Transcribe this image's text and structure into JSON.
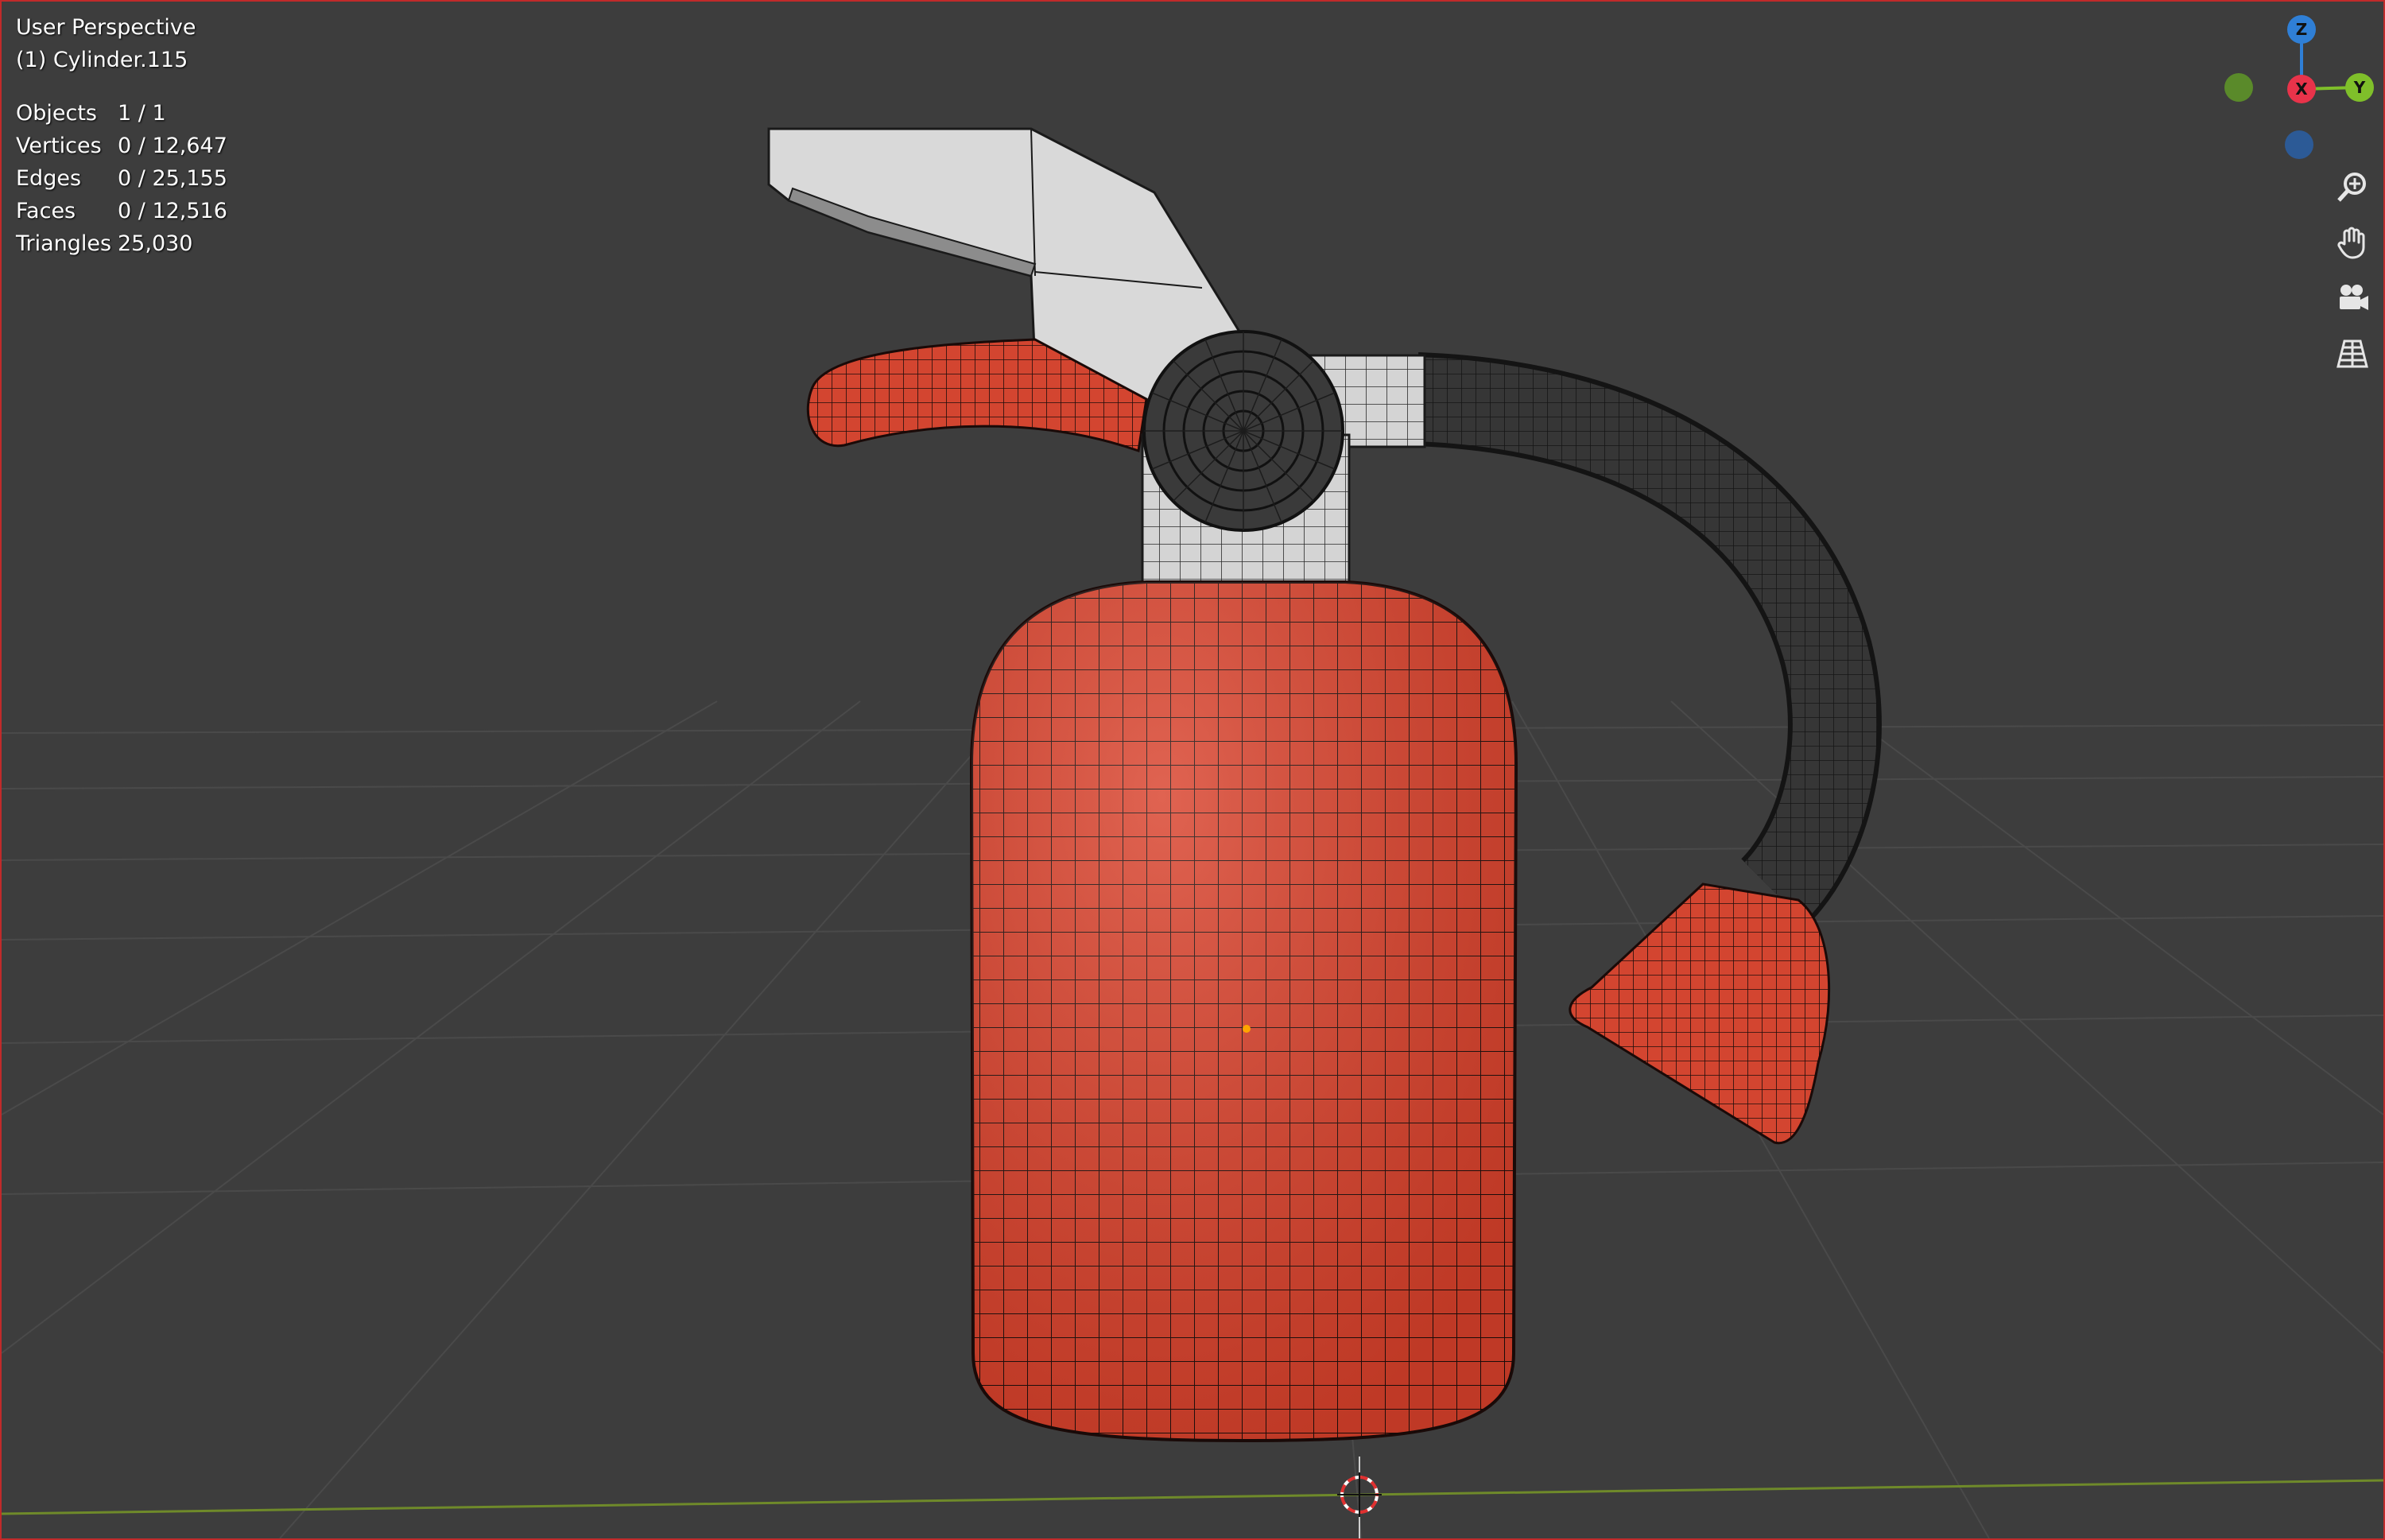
{
  "viewport": {
    "title": "User Perspective",
    "active_object": "(1) Cylinder.115"
  },
  "stats": [
    {
      "label": "Objects",
      "value": "1 / 1"
    },
    {
      "label": "Vertices",
      "value": "0 / 12,647"
    },
    {
      "label": "Edges",
      "value": "0 / 25,155"
    },
    {
      "label": "Faces",
      "value": "0 / 12,516"
    },
    {
      "label": "Triangles",
      "value": "25,030"
    }
  ],
  "gizmo": {
    "z_label": "Z",
    "x_label": "X",
    "y_label": "Y",
    "colors": {
      "x": "#e8334a",
      "y": "#7fbf2a",
      "z": "#2f7fd6",
      "y_neg": "#5a8a2a",
      "z_neg": "#2c5a96"
    }
  },
  "navigation": [
    {
      "name": "zoom-icon"
    },
    {
      "name": "pan-hand-icon"
    },
    {
      "name": "camera-view-icon"
    },
    {
      "name": "orthographic-grid-icon"
    }
  ],
  "colors": {
    "background": "#3d3d3d",
    "extinguisher_red": "#d9412b",
    "hose": "#333333",
    "metal": "#cfcfcf",
    "wire": "#1a1a1a",
    "border": "#c12a2a"
  }
}
